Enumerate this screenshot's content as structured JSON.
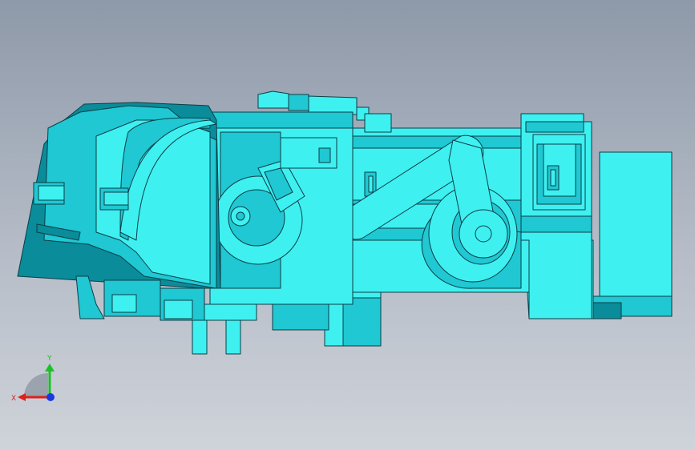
{
  "viewport": {
    "background_top": "#8e99a9",
    "background_bottom": "#cfd3da"
  },
  "model": {
    "color_face_light": "#3ff0f0",
    "color_face_mid": "#1fc8d2",
    "color_face_dark": "#0a8c9a",
    "color_edge": "#0b3e47"
  },
  "triad": {
    "x_label": "X",
    "y_label": "Y",
    "x_color": "#e0201a",
    "y_color": "#1fbf2a",
    "z_color": "#1a3adf"
  }
}
